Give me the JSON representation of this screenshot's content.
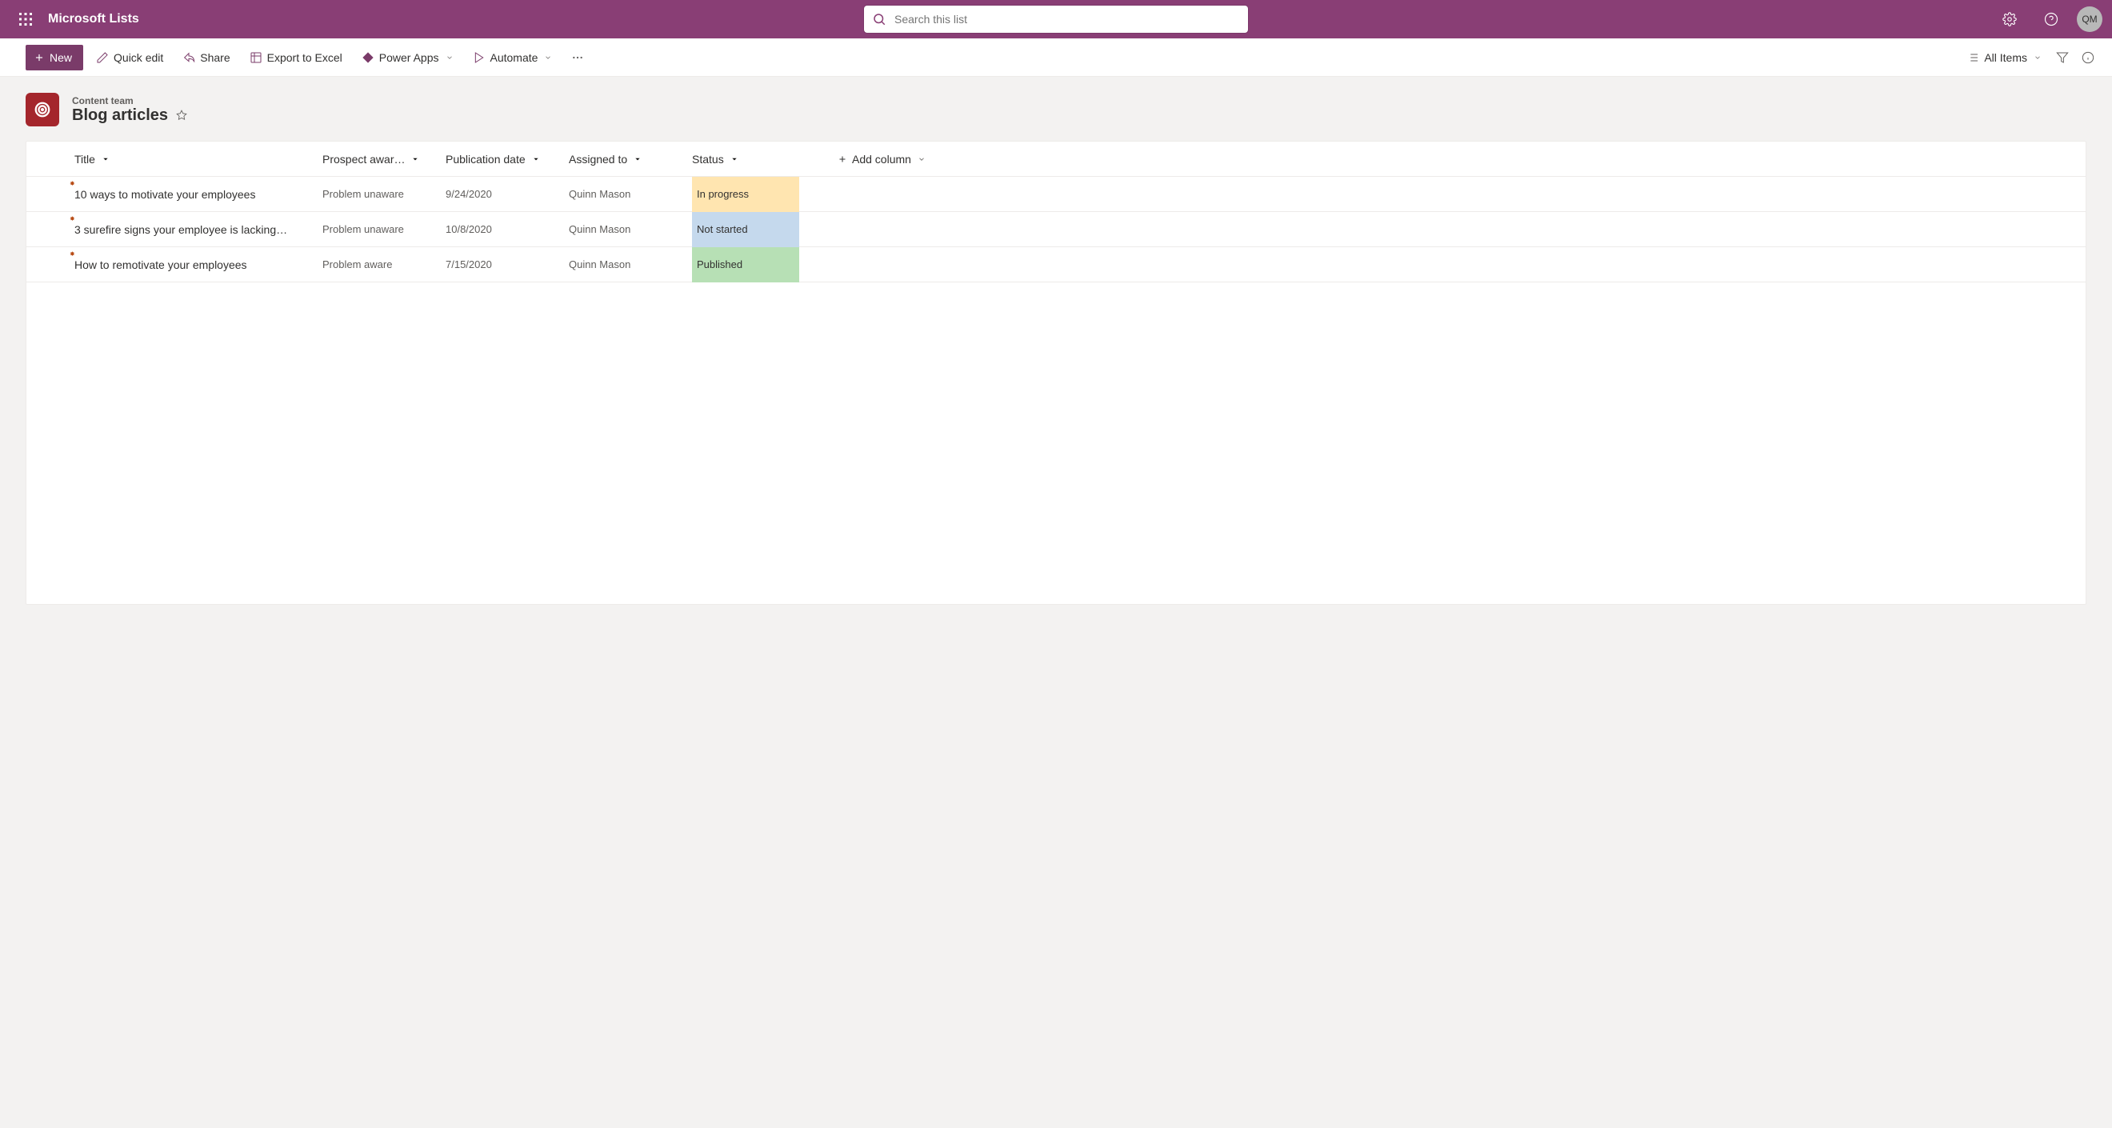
{
  "topbar": {
    "app_name": "Microsoft Lists",
    "search_placeholder": "Search this list",
    "avatar_initials": "QM"
  },
  "toolbar": {
    "new": "New",
    "quick_edit": "Quick edit",
    "share": "Share",
    "export": "Export to Excel",
    "power_apps": "Power Apps",
    "automate": "Automate",
    "all_items": "All Items"
  },
  "list": {
    "team": "Content team",
    "title": "Blog articles"
  },
  "columns": {
    "title": "Title",
    "prospect": "Prospect awar…",
    "publication": "Publication date",
    "assigned": "Assigned to",
    "status": "Status",
    "add": "Add column"
  },
  "rows": [
    {
      "title": "10 ways to motivate your employees",
      "prospect": "Problem unaware",
      "publication": "9/24/2020",
      "assigned": "Quinn Mason",
      "status": "In progress",
      "status_class": "status-in-progress"
    },
    {
      "title": "3 surefire signs your employee is lacking…",
      "prospect": "Problem unaware",
      "publication": "10/8/2020",
      "assigned": "Quinn Mason",
      "status": "Not started",
      "status_class": "status-not-started"
    },
    {
      "title": "How to remotivate your employees",
      "prospect": "Problem aware",
      "publication": "7/15/2020",
      "assigned": "Quinn Mason",
      "status": "Published",
      "status_class": "status-published"
    }
  ]
}
